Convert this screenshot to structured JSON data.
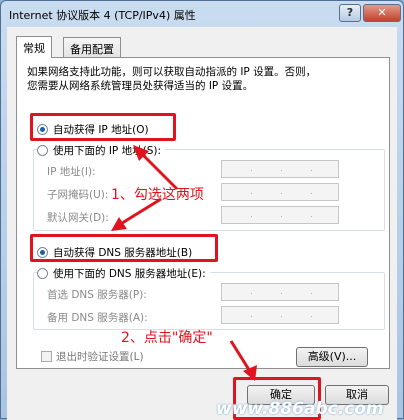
{
  "window": {
    "title": "Internet 协议版本 4 (TCP/IPv4) 属性",
    "help_label": "?",
    "close_label": "✕"
  },
  "tabs": [
    {
      "label": "常规"
    },
    {
      "label": "备用配置"
    }
  ],
  "description": {
    "line1": "如果网络支持此功能，则可以获取自动指派的 IP 设置。否则，",
    "line2": "您需要从网络系统管理员处获得适当的 IP 设置。"
  },
  "ip_section": {
    "auto_label": "自动获得 IP 地址(O)",
    "manual_label": "使用下面的 IP 地址(S):",
    "auto_selected": true,
    "fields": [
      {
        "label": "IP 地址(I):"
      },
      {
        "label": "子网掩码(U):"
      },
      {
        "label": "默认网关(D):"
      }
    ]
  },
  "dns_section": {
    "auto_label": "自动获得 DNS 服务器地址(B)",
    "manual_label": "使用下面的 DNS 服务器地址(E):",
    "auto_selected": true,
    "fields": [
      {
        "label": "首选 DNS 服务器(P):"
      },
      {
        "label": "备用 DNS 服务器(A):"
      }
    ]
  },
  "validate_label": "退出时验证设置(L)",
  "advanced_label": "高级(V)...",
  "ok_label": "确定",
  "cancel_label": "取消",
  "annotations": {
    "step1": "1、勾选这两项",
    "step2": "2、点击\"确定\""
  },
  "watermark": "www.886abc.com",
  "colors": {
    "annotation": "#e0141e",
    "radio_selected": "#1c5fa8"
  }
}
